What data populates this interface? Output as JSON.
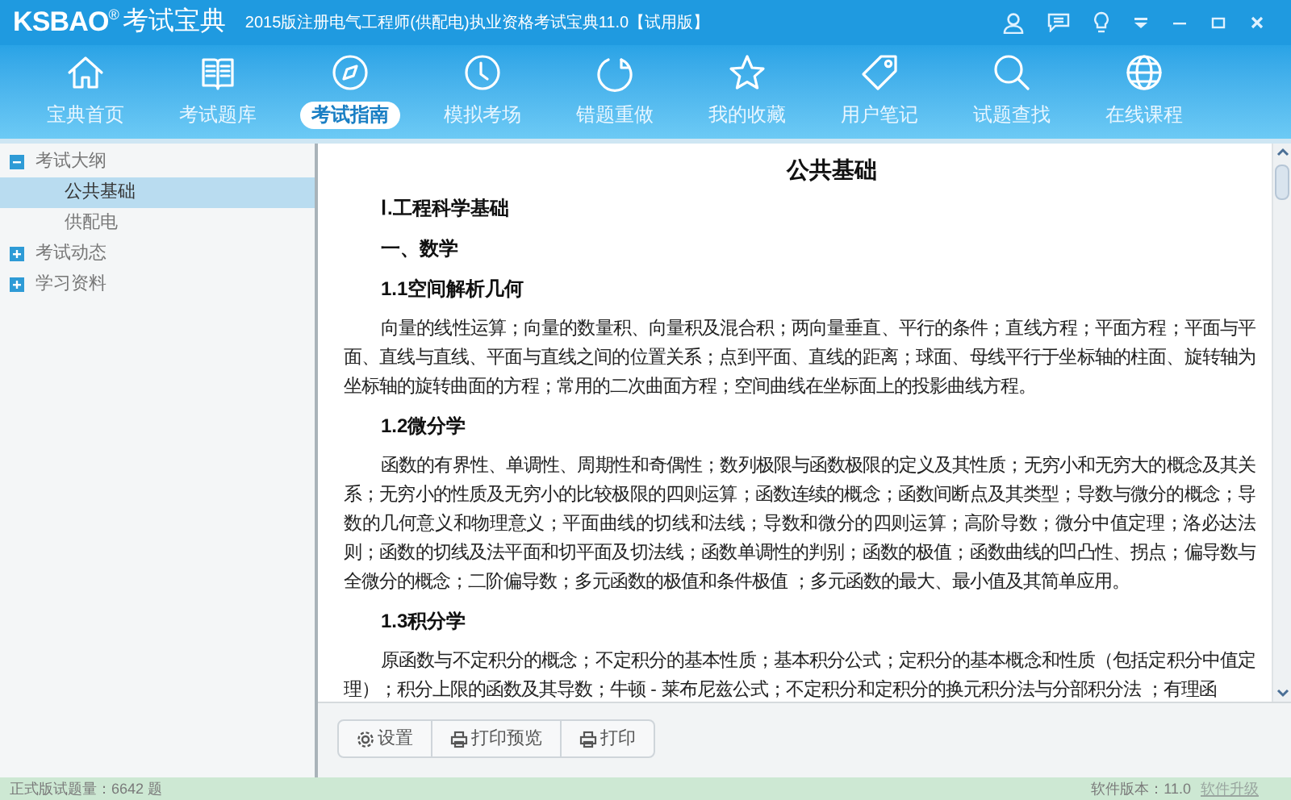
{
  "window": {
    "logo": "KSBAO",
    "logo_mark": "®",
    "logo_cn": "考试宝典",
    "title": "2015版注册电气工程师(供配电)执业资格考试宝典11.0【试用版】"
  },
  "nav": [
    {
      "label": "宝典首页",
      "kind": "home",
      "selected": false
    },
    {
      "label": "考试题库",
      "kind": "book",
      "selected": false
    },
    {
      "label": "考试指南",
      "kind": "compass",
      "selected": true
    },
    {
      "label": "模拟考场",
      "kind": "clock",
      "selected": false
    },
    {
      "label": "错题重做",
      "kind": "refresh",
      "selected": false
    },
    {
      "label": "我的收藏",
      "kind": "star",
      "selected": false
    },
    {
      "label": "用户笔记",
      "kind": "tag",
      "selected": false
    },
    {
      "label": "试题查找",
      "kind": "search",
      "selected": false
    },
    {
      "label": "在线课程",
      "kind": "globe",
      "selected": false
    }
  ],
  "sidebar": {
    "items": [
      {
        "label": "考试大纲",
        "expanded": true,
        "children": [
          {
            "label": "公共基础",
            "selected": true
          },
          {
            "label": "供配电",
            "selected": false
          }
        ]
      },
      {
        "label": "考试动态",
        "expanded": false
      },
      {
        "label": "学习资料",
        "expanded": false
      }
    ]
  },
  "document": {
    "title": "公共基础",
    "blocks": [
      {
        "kind": "heading",
        "text": "Ⅰ.工程科学基础"
      },
      {
        "kind": "heading",
        "text": "一、数学"
      },
      {
        "kind": "heading",
        "text": "1.1空间解析几何"
      },
      {
        "kind": "paragraph",
        "text": "向量的线性运算；向量的数量积、向量积及混合积；两向量垂直、平行的条件；直线方程；平面方程；平面与平面、直线与直线、平面与直线之间的位置关系；点到平面、直线的距离；球面、母线平行于坐标轴的柱面、旋转轴为坐标轴的旋转曲面的方程；常用的二次曲面方程；空间曲线在坐标面上的投影曲线方程。"
      },
      {
        "kind": "heading",
        "text": "1.2微分学"
      },
      {
        "kind": "paragraph",
        "text": "函数的有界性、单调性、周期性和奇偶性；数列极限与函数极限的定义及其性质；无穷小和无穷大的概念及其关系；无穷小的性质及无穷小的比较极限的四则运算；函数连续的概念；函数间断点及其类型；导数与微分的概念；导数的几何意义和物理意义；平面曲线的切线和法线；导数和微分的四则运算；高阶导数；微分中值定理；洛必达法则；函数的切线及法平面和切平面及切法线；函数单调性的判别；函数的极值；函数曲线的凹凸性、拐点；偏导数与全微分的概念；二阶偏导数；多元函数的极值和条件极值 ；多元函数的最大、最小值及其简单应用。"
      },
      {
        "kind": "heading",
        "text": "1.3积分学"
      },
      {
        "kind": "paragraph",
        "text": "原函数与不定积分的概念；不定积分的基本性质；基本积分公式；定积分的基本概念和性质（包括定积分中值定理）；积分上限的函数及其导数；牛顿 - 莱布尼兹公式；不定积分和定积分的换元积分法与分部积分法 ；有理函"
      }
    ]
  },
  "toolbar": [
    {
      "label": "设置",
      "kind": "gear"
    },
    {
      "label": "打印预览",
      "kind": "printer"
    },
    {
      "label": "打印",
      "kind": "printer"
    }
  ],
  "status_bar": {
    "left": "正式版试题量：6642 题",
    "version": "软件版本：11.0",
    "upgrade_link": "软件升级"
  }
}
